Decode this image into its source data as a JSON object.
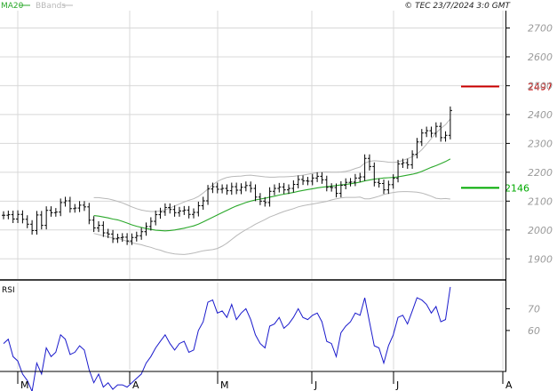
{
  "legend": {
    "ma_label": "MA20",
    "bb_label": "BBands"
  },
  "copyright": "© TEC 23/7/2024 3:0 GMT",
  "rsi_label": "RSI",
  "colors": {
    "price": "#000000",
    "ma": "#2aa82a",
    "bbands": "#b8b8b8",
    "grid": "#d8d8d8",
    "rsi": "#1a1acc",
    "resistance": "#cc0000",
    "support": "#00aa00",
    "axis_text": "#9a9a9a",
    "frame": "#000000"
  },
  "chart_data": [
    {
      "type": "ohlc",
      "title": "",
      "ylim": [
        1830,
        2760
      ],
      "y_ticks": [
        1900,
        2000,
        2100,
        2200,
        2300,
        2400,
        2500,
        2600,
        2700
      ],
      "y_tick_labels": [
        "1900",
        "2000",
        "2100",
        "2200",
        "2300",
        "2400",
        "2500",
        "2600",
        "2700"
      ],
      "x_month_labels": [
        "M",
        "A",
        "M",
        "J",
        "J",
        "A"
      ],
      "grid": true,
      "levels": [
        {
          "name": "resistance",
          "value": 2497,
          "label": "2497"
        },
        {
          "name": "support",
          "value": 2146,
          "label": "2146"
        }
      ],
      "series": [
        {
          "name": "Price",
          "style": "ohlc-bars",
          "close": [
            2051,
            2053,
            2038,
            2054,
            2037,
            2020,
            1998,
            2052,
            2016,
            2068,
            2060,
            2062,
            2095,
            2101,
            2074,
            2076,
            2086,
            2080,
            2034,
            2007,
            2016,
            1990,
            1986,
            1969,
            1973,
            1975,
            1962,
            1974,
            1980,
            1994,
            2012,
            2030,
            2053,
            2063,
            2078,
            2071,
            2060,
            2066,
            2069,
            2054,
            2061,
            2084,
            2101,
            2142,
            2150,
            2141,
            2144,
            2136,
            2150,
            2138,
            2148,
            2154,
            2144,
            2114,
            2100,
            2095,
            2134,
            2144,
            2149,
            2139,
            2144,
            2158,
            2175,
            2170,
            2169,
            2180,
            2186,
            2174,
            2148,
            2147,
            2127,
            2155,
            2165,
            2166,
            2180,
            2184,
            2248,
            2220,
            2165,
            2161,
            2139,
            2157,
            2179,
            2229,
            2233,
            2226,
            2262,
            2305,
            2336,
            2344,
            2335,
            2359,
            2320,
            2328,
            2414
          ]
        },
        {
          "name": "MA20",
          "style": "line",
          "values": [
            null,
            null,
            null,
            null,
            null,
            null,
            null,
            null,
            null,
            null,
            null,
            null,
            null,
            null,
            null,
            null,
            null,
            null,
            null,
            2050,
            2048,
            2045,
            2042,
            2038,
            2035,
            2030,
            2024,
            2018,
            2013,
            2009,
            2005,
            2002,
            1999,
            1998,
            1997,
            1998,
            2000,
            2003,
            2006,
            2010,
            2014,
            2020,
            2028,
            2036,
            2044,
            2052,
            2060,
            2068,
            2076,
            2083,
            2089,
            2095,
            2100,
            2104,
            2107,
            2110,
            2114,
            2117,
            2121,
            2124,
            2127,
            2130,
            2134,
            2137,
            2140,
            2143,
            2146,
            2148,
            2150,
            2152,
            2154,
            2156,
            2158,
            2160,
            2163,
            2166,
            2170,
            2173,
            2176,
            2178,
            2180,
            2181,
            2182,
            2184,
            2187,
            2190,
            2193,
            2197,
            2203,
            2210,
            2217,
            2223,
            2230,
            2237,
            2246
          ]
        },
        {
          "name": "BBands upper",
          "style": "line",
          "values": [
            null,
            null,
            null,
            null,
            null,
            null,
            null,
            null,
            null,
            null,
            null,
            null,
            null,
            null,
            null,
            null,
            null,
            null,
            null,
            2112,
            2112,
            2110,
            2108,
            2104,
            2099,
            2094,
            2087,
            2080,
            2074,
            2069,
            2066,
            2064,
            2064,
            2066,
            2070,
            2076,
            2083,
            2090,
            2097,
            2103,
            2108,
            2116,
            2128,
            2142,
            2156,
            2168,
            2176,
            2182,
            2185,
            2186,
            2187,
            2189,
            2190,
            2188,
            2186,
            2184,
            2183,
            2183,
            2184,
            2184,
            2185,
            2186,
            2188,
            2190,
            2193,
            2196,
            2199,
            2200,
            2201,
            2200,
            2200,
            2201,
            2203,
            2207,
            2213,
            2218,
            2232,
            2238,
            2240,
            2239,
            2237,
            2235,
            2234,
            2236,
            2241,
            2247,
            2254,
            2263,
            2278,
            2297,
            2317,
            2336,
            2352,
            2365,
            2385
          ]
        },
        {
          "name": "BBands lower",
          "style": "line",
          "values": [
            null,
            null,
            null,
            null,
            null,
            null,
            null,
            null,
            null,
            null,
            null,
            null,
            null,
            null,
            null,
            null,
            null,
            null,
            null,
            1988,
            1984,
            1980,
            1976,
            1972,
            1971,
            1966,
            1961,
            1956,
            1952,
            1949,
            1944,
            1940,
            1934,
            1930,
            1924,
            1920,
            1917,
            1916,
            1915,
            1917,
            1920,
            1924,
            1928,
            1930,
            1932,
            1936,
            1944,
            1954,
            1967,
            1980,
            1991,
            2001,
            2010,
            2020,
            2028,
            2036,
            2045,
            2051,
            2058,
            2064,
            2069,
            2074,
            2080,
            2084,
            2087,
            2090,
            2093,
            2096,
            2099,
            2104,
            2108,
            2111,
            2113,
            2113,
            2113,
            2114,
            2108,
            2108,
            2112,
            2117,
            2123,
            2127,
            2130,
            2132,
            2133,
            2133,
            2132,
            2131,
            2128,
            2123,
            2117,
            2110,
            2108,
            2109,
            2107
          ]
        }
      ]
    },
    {
      "type": "line",
      "title": "",
      "ylim": [
        42,
        82
      ],
      "y_ticks": [
        60,
        70
      ],
      "y_tick_labels": [
        "60",
        "70"
      ],
      "series": [
        {
          "name": "RSI",
          "values": [
            54,
            56,
            48,
            46,
            40,
            37,
            32,
            45,
            40,
            52,
            48,
            50,
            58,
            56,
            49,
            50,
            53,
            51,
            42,
            36,
            40,
            34,
            36,
            33,
            35,
            35,
            34,
            36,
            38,
            40,
            45,
            48,
            52,
            55,
            58,
            54,
            51,
            54,
            55,
            50,
            51,
            60,
            64,
            73,
            74,
            68,
            69,
            66,
            72,
            65,
            68,
            70,
            65,
            58,
            54,
            52,
            62,
            63,
            66,
            61,
            63,
            66,
            70,
            66,
            65,
            67,
            68,
            64,
            55,
            54,
            48,
            59,
            62,
            64,
            68,
            67,
            75,
            64,
            53,
            52,
            45,
            53,
            58,
            66,
            67,
            63,
            69,
            75,
            74,
            72,
            68,
            71,
            64,
            65,
            80
          ]
        }
      ]
    }
  ]
}
